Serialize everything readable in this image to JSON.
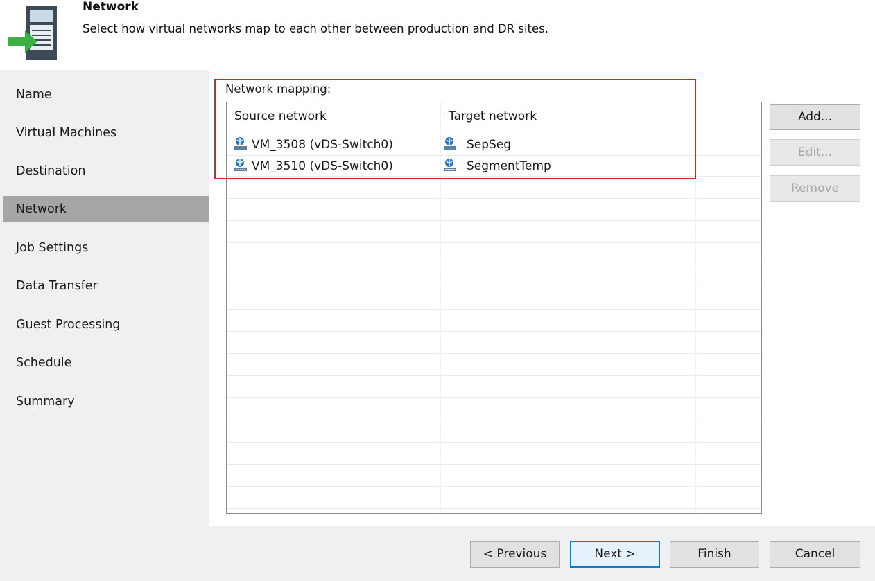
{
  "header": {
    "title": "Network",
    "subtitle": "Select how virtual networks map to each other between production and DR sites.",
    "icon": "network-wizard-icon"
  },
  "sidebar": {
    "items": [
      {
        "label": "Name",
        "active": false
      },
      {
        "label": "Virtual Machines",
        "active": false
      },
      {
        "label": "Destination",
        "active": false
      },
      {
        "label": "Network",
        "active": true
      },
      {
        "label": "Job Settings",
        "active": false
      },
      {
        "label": "Data Transfer",
        "active": false
      },
      {
        "label": "Guest Processing",
        "active": false
      },
      {
        "label": "Schedule",
        "active": false
      },
      {
        "label": "Summary",
        "active": false
      }
    ]
  },
  "mapping": {
    "label": "Network mapping:",
    "columns": [
      "Source network",
      "Target network"
    ],
    "rows": [
      {
        "source": "VM_3508 (vDS-Switch0)",
        "target": "SepSeg"
      },
      {
        "source": "VM_3510 (vDS-Switch0)",
        "target": "SegmentTemp"
      }
    ],
    "row_icon": "virtual-network-icon"
  },
  "side_buttons": {
    "add": "Add...",
    "edit": "Edit...",
    "remove": "Remove"
  },
  "footer": {
    "previous": "< Previous",
    "next": "Next >",
    "finish": "Finish",
    "cancel": "Cancel"
  },
  "colors": {
    "highlight": "#e0201e",
    "active_nav": "#a6a6a6",
    "panel_bg": "#f0f0f0",
    "primary_border": "#0a7ad6"
  }
}
